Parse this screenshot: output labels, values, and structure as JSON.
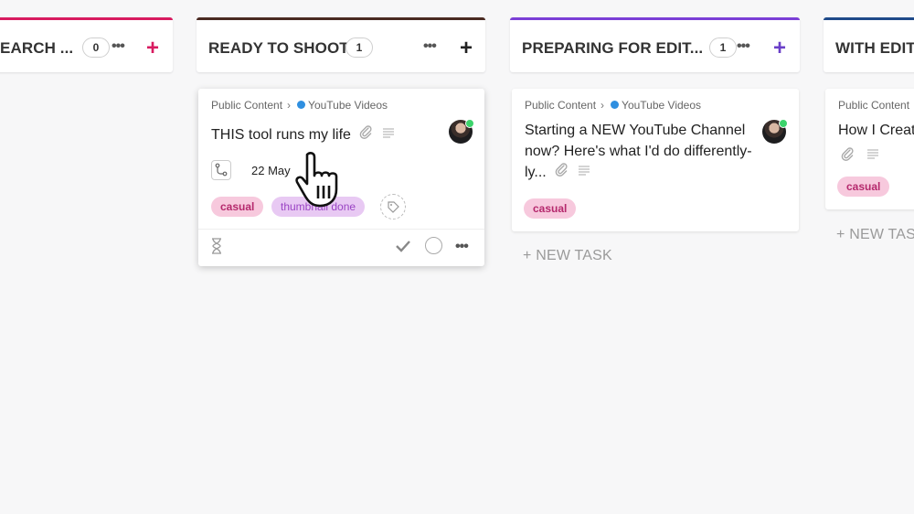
{
  "columns": [
    {
      "title": "EARCH ...",
      "count": "0",
      "accent": "#d81b60",
      "plus_color": "#d81b60"
    },
    {
      "title": "READY TO SHOOT",
      "count": "1",
      "accent": "#4a2a22",
      "plus_color": "#222222",
      "cards": [
        {
          "breadcrumb_parent": "Public Content",
          "breadcrumb_child": "YouTube Videos",
          "title": "THIS tool runs my life",
          "date": "22 May",
          "tags": [
            "casual",
            "thumbnail done"
          ]
        }
      ]
    },
    {
      "title": "PREPARING FOR EDIT...",
      "count": "1",
      "accent": "#7b3fd6",
      "plus_color": "#6a3fc8",
      "cards": [
        {
          "breadcrumb_parent": "Public Content",
          "breadcrumb_child": "YouTube Videos",
          "title_lines": [
            "Starting a NEW YouTube Channel",
            "now? Here's what I'd do differently-",
            "ly..."
          ],
          "tags": [
            "casual"
          ]
        }
      ],
      "new_task": "+ NEW TASK"
    },
    {
      "title": "WITH EDITO",
      "accent": "#1f4a8a",
      "cards": [
        {
          "breadcrumb_parent": "Public Content",
          "title": "How I Creat",
          "tags": [
            "casual"
          ]
        }
      ],
      "new_task": "+ NEW TAS"
    }
  ],
  "icons": {
    "more": "more-horizontal-icon",
    "add": "plus-icon",
    "attachment": "paperclip-icon",
    "description": "text-lines-icon",
    "subtask": "subtask-branch-icon",
    "time": "hourglass-icon",
    "complete": "checkmark-icon",
    "status": "circle-icon",
    "tag": "tag-icon",
    "cursor": "hand-pointer-icon"
  }
}
